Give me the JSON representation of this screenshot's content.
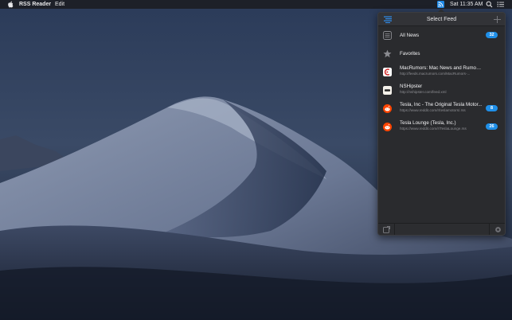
{
  "menubar": {
    "app_name": "RSS Reader",
    "menus": [
      "Edit"
    ],
    "clock": "Sat 11:35 AM"
  },
  "popover": {
    "title": "Select Feed",
    "feeds": [
      {
        "name": "All News",
        "url": "",
        "badge": "32",
        "icon": "list-icon"
      },
      {
        "name": "Favorites",
        "url": "",
        "badge": "",
        "icon": "star-icon"
      },
      {
        "name": "MacRumors: Mac News and Rumors...",
        "url": "http://feeds.macrumors.com/MacRumors-...",
        "badge": "",
        "icon": "macrumors-icon"
      },
      {
        "name": "NSHipster",
        "url": "http://nshipster.com/feed.xml",
        "badge": "",
        "icon": "nshipster-icon"
      },
      {
        "name": "Tesla, Inc - The Original Tesla Motor...",
        "url": "https://www.reddit.com/r/teslamotors/.rss",
        "badge": "8",
        "icon": "reddit-icon"
      },
      {
        "name": "Tesla Lounge (Tesla, Inc.)",
        "url": "https://www.reddit.com/r/TeslaLounge.rss",
        "badge": "26",
        "icon": "reddit-icon"
      }
    ]
  },
  "colors": {
    "accent": "#1f8fe8",
    "popover_bg": "#2a2b2e",
    "menubar_bg": "#1c1e24"
  }
}
